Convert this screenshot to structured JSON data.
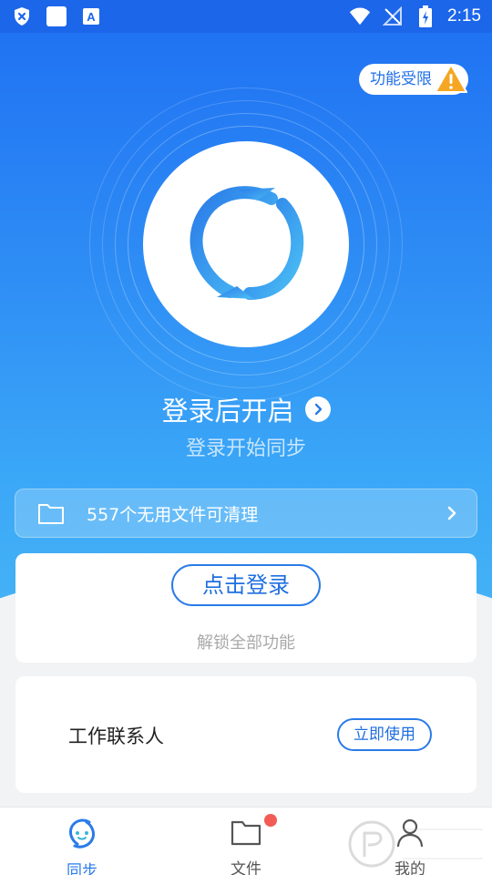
{
  "status_bar": {
    "time": "2:15",
    "left_icons": [
      "shield-x-icon",
      "white-square-icon",
      "font-a-icon"
    ],
    "right_icons": [
      "wifi-icon",
      "no-signal-icon",
      "battery-charging-icon"
    ]
  },
  "header": {
    "limited_badge": "功能受限"
  },
  "hero": {
    "title": "登录后开启",
    "subtitle": "登录开始同步"
  },
  "clean_bar": {
    "text": "557个无用文件可清理"
  },
  "login_card": {
    "button": "点击登录",
    "hint": "解锁全部功能"
  },
  "contacts_card": {
    "label": "工作联系人",
    "button": "立即使用"
  },
  "tabs": [
    {
      "label": "同步",
      "icon": "sync-icon",
      "active": true
    },
    {
      "label": "文件",
      "icon": "folder-icon",
      "badge": true
    },
    {
      "label": "我的",
      "icon": "user-icon"
    }
  ],
  "colors": {
    "primary": "#2a7be8",
    "hero_top": "#1e6ff2",
    "hero_bottom": "#45b3f6",
    "warning": "#f5a623",
    "badge_red": "#f25c54"
  }
}
